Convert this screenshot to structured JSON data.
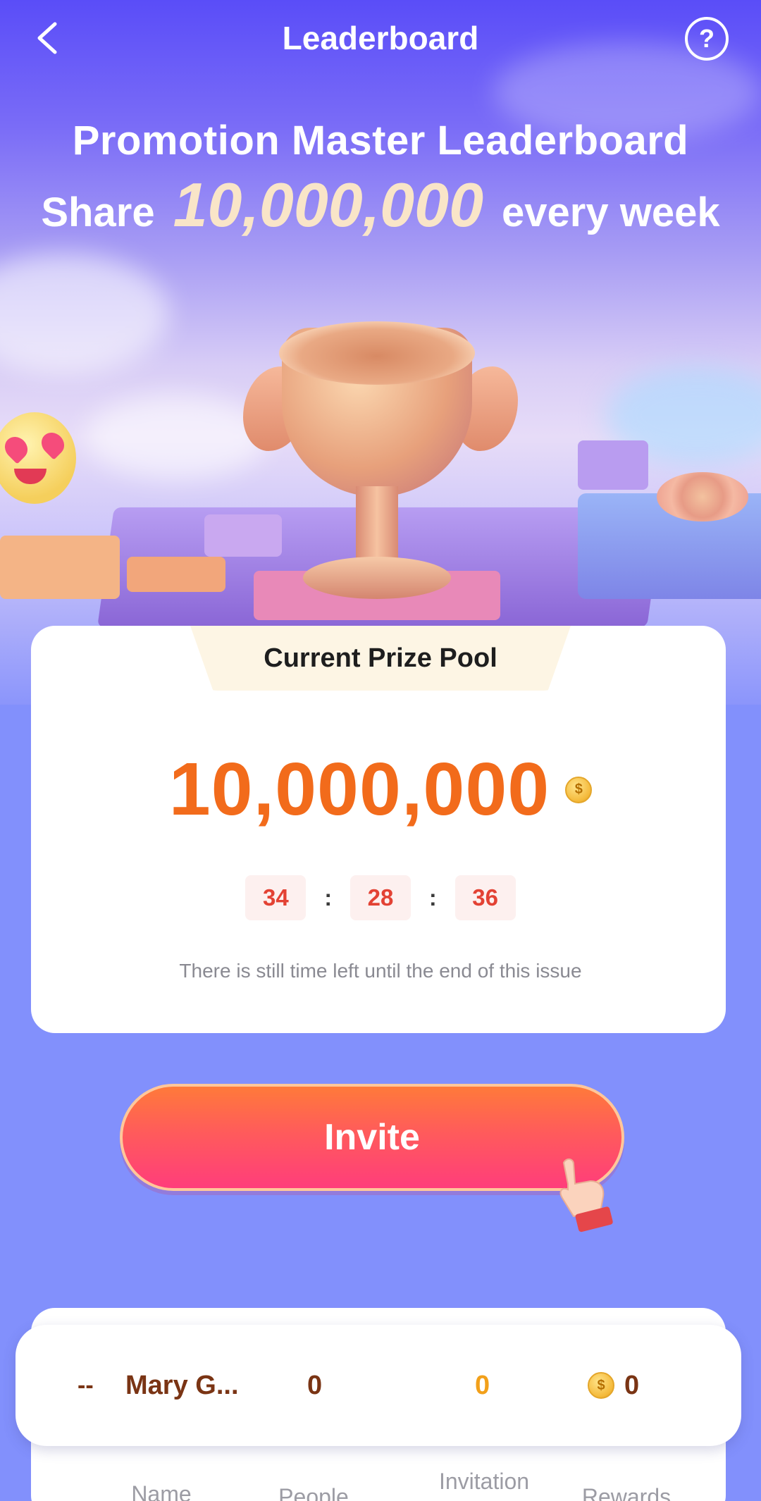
{
  "header": {
    "title": "Leaderboard",
    "help_symbol": "?"
  },
  "hero": {
    "headline": "Promotion Master Leaderboard",
    "share_prefix": "Share",
    "share_amount": "10,000,000",
    "share_suffix": "every week"
  },
  "prize": {
    "tab_label": "Current Prize Pool",
    "amount": "10,000,000",
    "coin_symbol": "$",
    "timer": {
      "hours": "34",
      "minutes": "28",
      "seconds": "36",
      "separator": ":"
    },
    "hint": "There is still time left until the end of this issue"
  },
  "invite": {
    "label": "Invite"
  },
  "my_rank": {
    "rank": "--",
    "name": "Mary G...",
    "people": "0",
    "invitation": "0",
    "rewards": "0"
  },
  "table": {
    "columns": [
      "Name",
      "People",
      "Invitation",
      "Rewards"
    ]
  },
  "colors": {
    "accent_orange": "#f26b1b",
    "timer_red": "#e34234",
    "invite_pink": "#ff3d7b",
    "background_blue": "#8290fc",
    "brown_text": "#7a3414",
    "gold_text": "#f2a01a"
  }
}
